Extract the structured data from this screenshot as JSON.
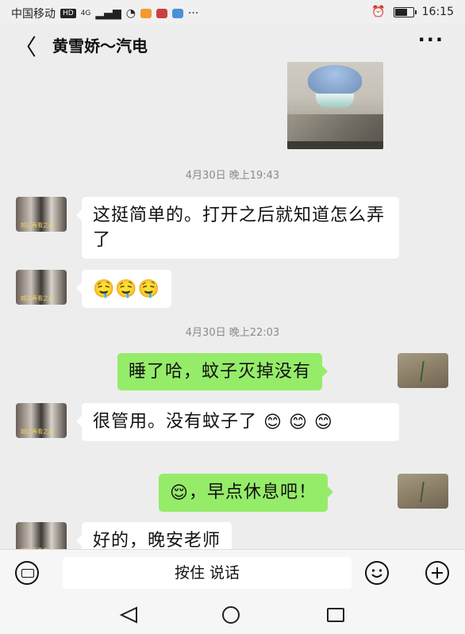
{
  "status_bar": {
    "carrier": "中国移动",
    "hd": "HD",
    "network": "4G",
    "dots": "···",
    "time": "16:15"
  },
  "header": {
    "title": "黄雪娇～汽电",
    "more": "···"
  },
  "messages": [
    {
      "kind": "time",
      "text": "4月30日 晚上19:43"
    },
    {
      "kind": "incoming",
      "text": "这挺简单的。打开之后就知道怎么弄了"
    },
    {
      "kind": "incoming",
      "emoji": [
        "🤤",
        "🤤",
        "🤤"
      ]
    },
    {
      "kind": "time",
      "text": "4月30日 晚上22:03"
    },
    {
      "kind": "outgoing",
      "text": "睡了哈，蚊子灭掉没有"
    },
    {
      "kind": "incoming",
      "text": "很管用。没有蚊子了",
      "emoji": [
        "😊",
        "😊",
        "😊"
      ]
    },
    {
      "kind": "outgoing",
      "text": "，早点休息吧！",
      "emoji_prefix": "😌"
    },
    {
      "kind": "incoming",
      "text": "好的，晚安老师"
    }
  ],
  "input_bar": {
    "hold_to_talk": "按住 说话"
  }
}
